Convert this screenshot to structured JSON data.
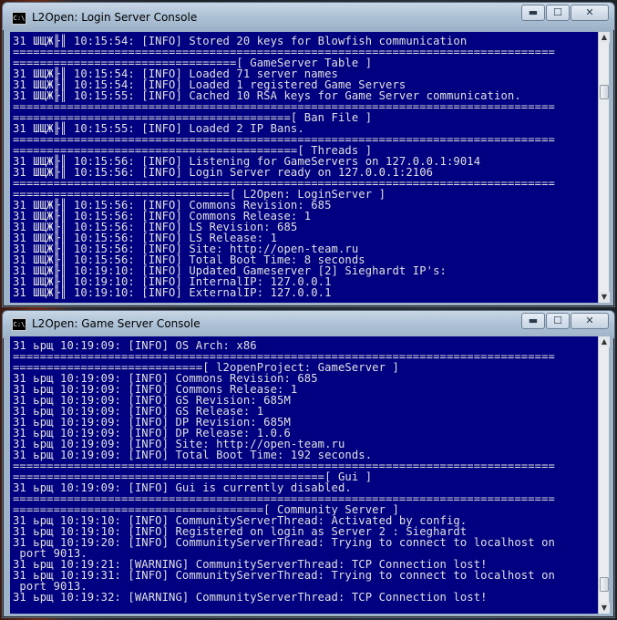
{
  "login_window": {
    "title": "L2Open:  Login Server Console",
    "icon_label": "C:\\",
    "controls": {
      "minimize": "▬",
      "maximize": "☐",
      "close": "✕"
    },
    "lines": [
      "31 ШЩЖ╟║ 10:15:54: [INFO] Stored 20 keys for Blowfish communication",
      "================================================================================",
      "=================================[ GameServer Table ]",
      "31 ШЩЖ╟║ 10:15:54: [INFO] Loaded 71 server names",
      "31 ШЩЖ╟║ 10:15:54: [INFO] Loaded 1 registered Game Servers",
      "31 ШЩЖ╟║ 10:15:55: [INFO] Cached 10 RSA keys for Game Server communication.",
      "================================================================================",
      "=========================================[ Ban File ]",
      "31 ШЩЖ╟║ 10:15:55: [INFO] Loaded 2 IP Bans.",
      "================================================================================",
      "==========================================[ Threads ]",
      "31 ШЩЖ╟║ 10:15:56: [INFO] Listening for GameServers on 127.0.0.1:9014",
      "31 ШЩЖ╟║ 10:15:56: [INFO] Login Server ready on 127.0.0.1:2106",
      "================================================================================",
      "================================[ L2Open: LoginServer ]",
      "31 ШЩЖ╟║ 10:15:56: [INFO] Commons Revision: 685",
      "31 ШЩЖ╟║ 10:15:56: [INFO] Commons Release: 1",
      "31 ШЩЖ╟║ 10:15:56: [INFO] LS Revision: 685",
      "31 ШЩЖ╟║ 10:15:56: [INFO] LS Release: 1",
      "31 ШЩЖ╟║ 10:15:56: [INFO] Site: http://open-team.ru",
      "31 ШЩЖ╟║ 10:15:56: [INFO] Total Boot Time: 8 seconds",
      "31 ШЩЖ╟║ 10:19:10: [INFO] Updated Gameserver [2] Sieghardt IP's:",
      "31 ШЩЖ╟║ 10:19:10: [INFO] InternalIP: 127.0.0.1",
      "31 ШЩЖ╟║ 10:19:10: [INFO] ExternalIP: 127.0.0.1"
    ]
  },
  "game_window": {
    "title": "L2Open: Game Server Console",
    "icon_label": "C:\\",
    "controls": {
      "minimize": "▬",
      "maximize": "☐",
      "close": "✕"
    },
    "lines": [
      "31 ьрщ 10:19:09: [INFO] OS Arch: x86",
      "================================================================================",
      "============================[ l2openProject: GameServer ]",
      "31 ьрщ 10:19:09: [INFO] Commons Revision: 685",
      "31 ьрщ 10:19:09: [INFO] Commons Release: 1",
      "31 ьрщ 10:19:09: [INFO] GS Revision: 685M",
      "31 ьрщ 10:19:09: [INFO] GS Release: 1",
      "31 ьрщ 10:19:09: [INFO] DP Revision: 685M",
      "31 ьрщ 10:19:09: [INFO] DP Release: 1.0.6",
      "31 ьрщ 10:19:09: [INFO] Site: http://open-team.ru",
      "31 ьрщ 10:19:09: [INFO] Total Boot Time: 192 seconds.",
      "================================================================================",
      "==============================================[ Gui ]",
      "31 ьрщ 10:19:09: [INFO] Gui is currently disabled.",
      "================================================================================",
      "=====================================[ Community Server ]",
      "31 ьрщ 10:19:10: [INFO] CommunityServerThread: Activated by config.",
      "31 ьрщ 10:19:10: [INFO] Registered on login as Server 2 : Sieghardt",
      "31 ьрщ 10:19:20: [INFO] CommunityServerThread: Trying to connect to localhost on",
      " port 9013.",
      "31 ьрщ 10:19:21: [WARNING] CommunityServerThread: TCP Connection lost!",
      "31 ьрщ 10:19:31: [INFO] CommunityServerThread: Trying to connect to localhost on",
      " port 9013.",
      "31 ьрщ 10:19:32: [WARNING] CommunityServerThread: TCP Connection lost!"
    ]
  }
}
